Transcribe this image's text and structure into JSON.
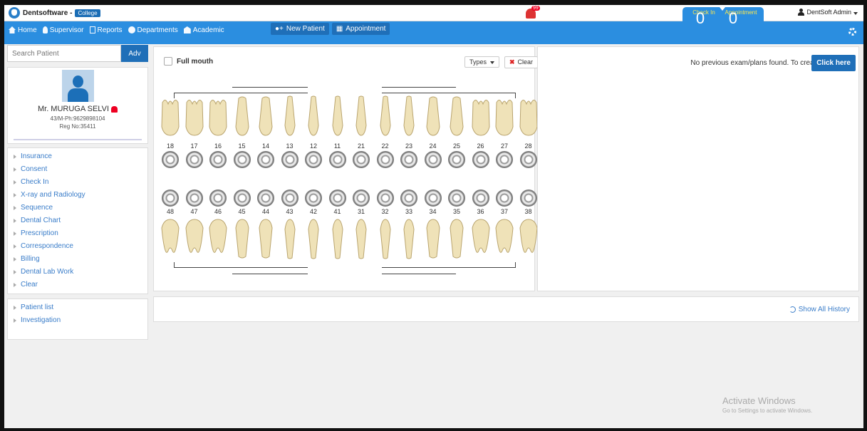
{
  "topbar": {
    "brand_name": "Dentsoftware -",
    "brand_tag": "College",
    "alert_count": "99",
    "check_in_count": "0",
    "check_in_label": "Check In",
    "appointment_count": "0",
    "appointment_label": "Appointment",
    "user": "DentSoft Admin"
  },
  "nav": {
    "items": [
      "Home",
      "Supervisor",
      "Reports",
      "Departments",
      "Academic"
    ],
    "new_patient": "New Patient",
    "appointment": "Appointment"
  },
  "sidebar": {
    "search_placeholder": "Search Patient",
    "adv_label": "Adv",
    "patient": {
      "name": "Mr. MURUGA SELVI",
      "meta": "43/M-Ph:9629898104",
      "reg": "Reg No:35411"
    },
    "menu": [
      "Insurance",
      "Consent",
      "Check In",
      "X-ray and Radiology",
      "Sequence",
      "Dental Chart",
      "Prescription",
      "Correspondence",
      "Billing",
      "Dental Lab Work",
      "Clear"
    ],
    "menu2": [
      "Patient list",
      "Investigation"
    ]
  },
  "chart": {
    "full_mouth_label": "Full mouth",
    "types_label": "Types",
    "clear_label": "Clear",
    "upper_numbers": [
      "18",
      "17",
      "16",
      "15",
      "14",
      "13",
      "12",
      "11",
      "21",
      "22",
      "23",
      "24",
      "25",
      "26",
      "27",
      "28"
    ],
    "lower_numbers": [
      "48",
      "47",
      "46",
      "45",
      "44",
      "43",
      "42",
      "41",
      "31",
      "32",
      "33",
      "34",
      "35",
      "36",
      "37",
      "38"
    ]
  },
  "right_panel": {
    "no_exam_text": "No previous exam/plans found. To create",
    "click_here": "Click here"
  },
  "history": {
    "show_all": "Show All History"
  },
  "watermark": {
    "title": "Activate Windows",
    "subtitle": "Go to Settings to activate Windows."
  }
}
